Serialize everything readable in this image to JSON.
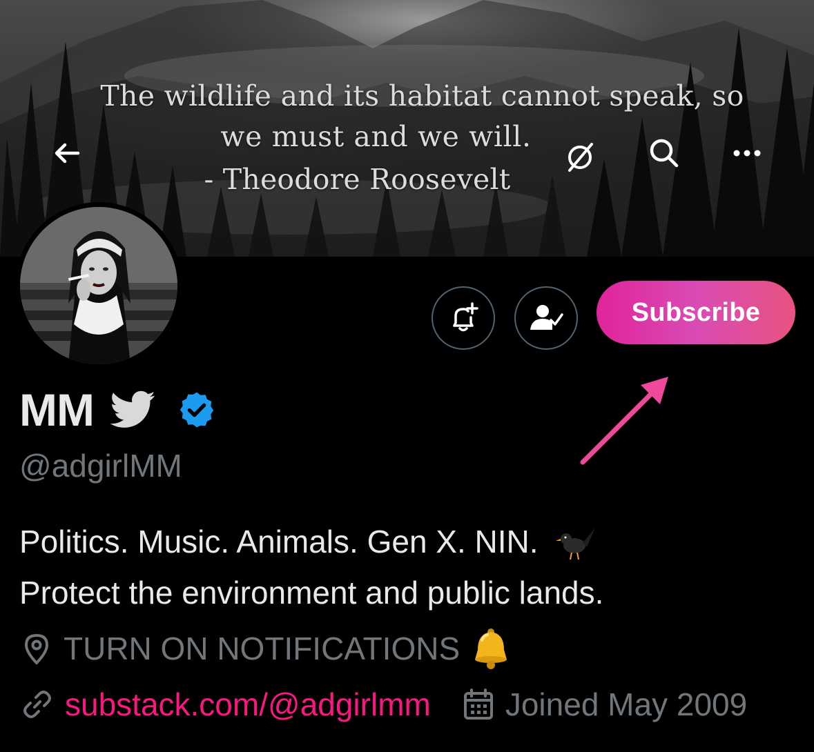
{
  "banner": {
    "quote_line1": "The wildlife and its habitat cannot speak, so",
    "quote_line2": "we must and we will.",
    "quote_line3": "- Theodore Roosevelt"
  },
  "header": {
    "back_icon": "arrow-left-icon",
    "grok_icon": "slash-circle-icon",
    "search_icon": "search-icon",
    "more_icon": "more-horizontal-icon"
  },
  "actions": {
    "notify_icon": "bell-plus-icon",
    "following_icon": "person-check-icon",
    "subscribe_label": "Subscribe",
    "subscribe_gradient": [
      "#e0249a",
      "#d94bb4",
      "#e85380"
    ],
    "arrow_color": "#f0489a"
  },
  "profile": {
    "display_name": "MM",
    "handle": "@adgirlMM",
    "verified_color": "#1d9bf0",
    "bio_line1": "Politics. Music. Animals. Gen X. NIN.",
    "bio_line2": "Protect the environment and public lands.",
    "location": "TURN ON NOTIFICATIONS",
    "website": "substack.com/@adgirlmm",
    "joined": "Joined May 2009"
  },
  "colors": {
    "background": "#000000",
    "text_primary": "#e7e9ea",
    "text_secondary": "#71767b",
    "link": "#f91880"
  }
}
